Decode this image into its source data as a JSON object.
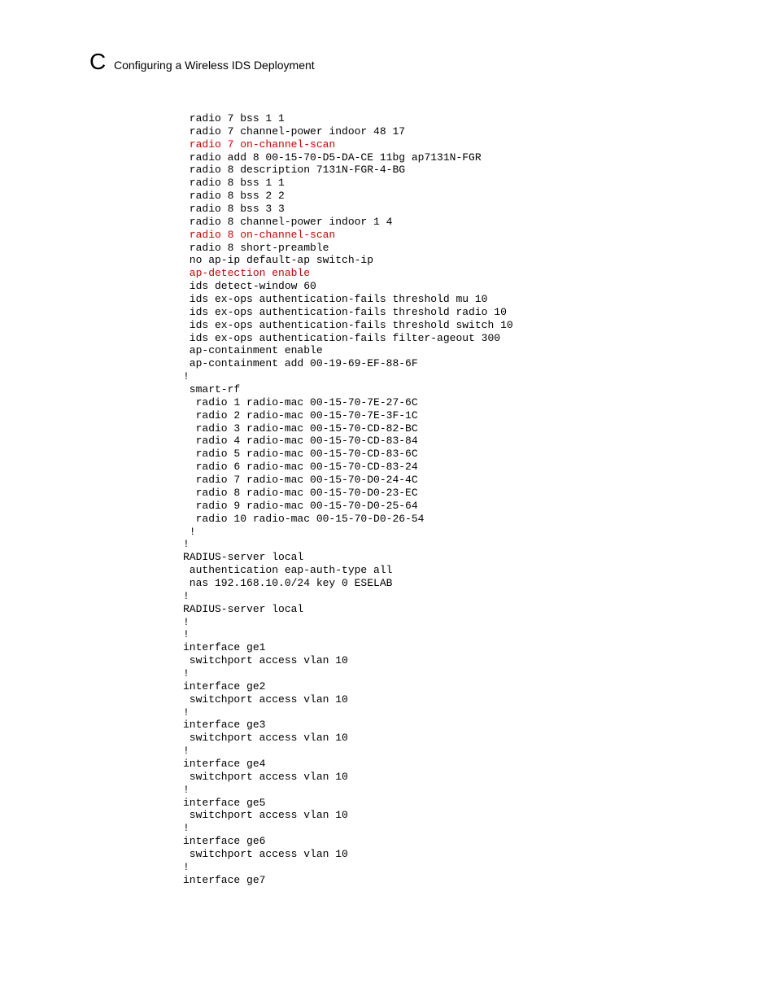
{
  "header": {
    "appendix_label": "C",
    "page_title": "Configuring a Wireless IDS Deployment"
  },
  "config": {
    "lines": [
      {
        "indent": 1,
        "text": "radio 7 bss 1 1",
        "red": false
      },
      {
        "indent": 1,
        "text": "radio 7 channel-power indoor 48 17",
        "red": false
      },
      {
        "indent": 1,
        "text": "radio 7 on-channel-scan",
        "red": true
      },
      {
        "indent": 1,
        "text": "radio add 8 00-15-70-D5-DA-CE 11bg ap7131N-FGR",
        "red": false
      },
      {
        "indent": 1,
        "text": "radio 8 description 7131N-FGR-4-BG",
        "red": false
      },
      {
        "indent": 1,
        "text": "radio 8 bss 1 1",
        "red": false
      },
      {
        "indent": 1,
        "text": "radio 8 bss 2 2",
        "red": false
      },
      {
        "indent": 1,
        "text": "radio 8 bss 3 3",
        "red": false
      },
      {
        "indent": 1,
        "text": "radio 8 channel-power indoor 1 4",
        "red": false
      },
      {
        "indent": 1,
        "text": "radio 8 on-channel-scan",
        "red": true
      },
      {
        "indent": 1,
        "text": "radio 8 short-preamble",
        "red": false
      },
      {
        "indent": 1,
        "text": "no ap-ip default-ap switch-ip",
        "red": false
      },
      {
        "indent": 1,
        "text": "ap-detection enable",
        "red": true
      },
      {
        "indent": 1,
        "text": "ids detect-window 60",
        "red": false
      },
      {
        "indent": 1,
        "text": "ids ex-ops authentication-fails threshold mu 10",
        "red": false
      },
      {
        "indent": 1,
        "text": "ids ex-ops authentication-fails threshold radio 10",
        "red": false
      },
      {
        "indent": 1,
        "text": "ids ex-ops authentication-fails threshold switch 10",
        "red": false
      },
      {
        "indent": 1,
        "text": "ids ex-ops authentication-fails filter-ageout 300",
        "red": false
      },
      {
        "indent": 1,
        "text": "ap-containment enable",
        "red": false
      },
      {
        "indent": 1,
        "text": "ap-containment add 00-19-69-EF-88-6F",
        "red": false
      },
      {
        "indent": 0,
        "text": "!",
        "red": false
      },
      {
        "indent": 1,
        "text": "smart-rf",
        "red": false
      },
      {
        "indent": 2,
        "text": "radio 1 radio-mac 00-15-70-7E-27-6C",
        "red": false
      },
      {
        "indent": 2,
        "text": "radio 2 radio-mac 00-15-70-7E-3F-1C",
        "red": false
      },
      {
        "indent": 2,
        "text": "radio 3 radio-mac 00-15-70-CD-82-BC",
        "red": false
      },
      {
        "indent": 2,
        "text": "radio 4 radio-mac 00-15-70-CD-83-84",
        "red": false
      },
      {
        "indent": 2,
        "text": "radio 5 radio-mac 00-15-70-CD-83-6C",
        "red": false
      },
      {
        "indent": 2,
        "text": "radio 6 radio-mac 00-15-70-CD-83-24",
        "red": false
      },
      {
        "indent": 2,
        "text": "radio 7 radio-mac 00-15-70-D0-24-4C",
        "red": false
      },
      {
        "indent": 2,
        "text": "radio 8 radio-mac 00-15-70-D0-23-EC",
        "red": false
      },
      {
        "indent": 2,
        "text": "radio 9 radio-mac 00-15-70-D0-25-64",
        "red": false
      },
      {
        "indent": 2,
        "text": "radio 10 radio-mac 00-15-70-D0-26-54",
        "red": false
      },
      {
        "indent": 1,
        "text": "!",
        "red": false
      },
      {
        "indent": 0,
        "text": "!",
        "red": false
      },
      {
        "indent": 0,
        "text": "RADIUS-server local",
        "red": false
      },
      {
        "indent": 1,
        "text": "authentication eap-auth-type all",
        "red": false
      },
      {
        "indent": 1,
        "text": "nas 192.168.10.0/24 key 0 ESELAB",
        "red": false
      },
      {
        "indent": 0,
        "text": "!",
        "red": false
      },
      {
        "indent": 0,
        "text": "RADIUS-server local",
        "red": false
      },
      {
        "indent": 0,
        "text": "!",
        "red": false
      },
      {
        "indent": 0,
        "text": "!",
        "red": false
      },
      {
        "indent": 0,
        "text": "interface ge1",
        "red": false
      },
      {
        "indent": 1,
        "text": "switchport access vlan 10",
        "red": false
      },
      {
        "indent": 0,
        "text": "!",
        "red": false
      },
      {
        "indent": 0,
        "text": "interface ge2",
        "red": false
      },
      {
        "indent": 1,
        "text": "switchport access vlan 10",
        "red": false
      },
      {
        "indent": 0,
        "text": "!",
        "red": false
      },
      {
        "indent": 0,
        "text": "interface ge3",
        "red": false
      },
      {
        "indent": 1,
        "text": "switchport access vlan 10",
        "red": false
      },
      {
        "indent": 0,
        "text": "!",
        "red": false
      },
      {
        "indent": 0,
        "text": "interface ge4",
        "red": false
      },
      {
        "indent": 1,
        "text": "switchport access vlan 10",
        "red": false
      },
      {
        "indent": 0,
        "text": "!",
        "red": false
      },
      {
        "indent": 0,
        "text": "interface ge5",
        "red": false
      },
      {
        "indent": 1,
        "text": "switchport access vlan 10",
        "red": false
      },
      {
        "indent": 0,
        "text": "!",
        "red": false
      },
      {
        "indent": 0,
        "text": "interface ge6",
        "red": false
      },
      {
        "indent": 1,
        "text": "switchport access vlan 10",
        "red": false
      },
      {
        "indent": 0,
        "text": "!",
        "red": false
      },
      {
        "indent": 0,
        "text": "interface ge7",
        "red": false
      }
    ]
  }
}
